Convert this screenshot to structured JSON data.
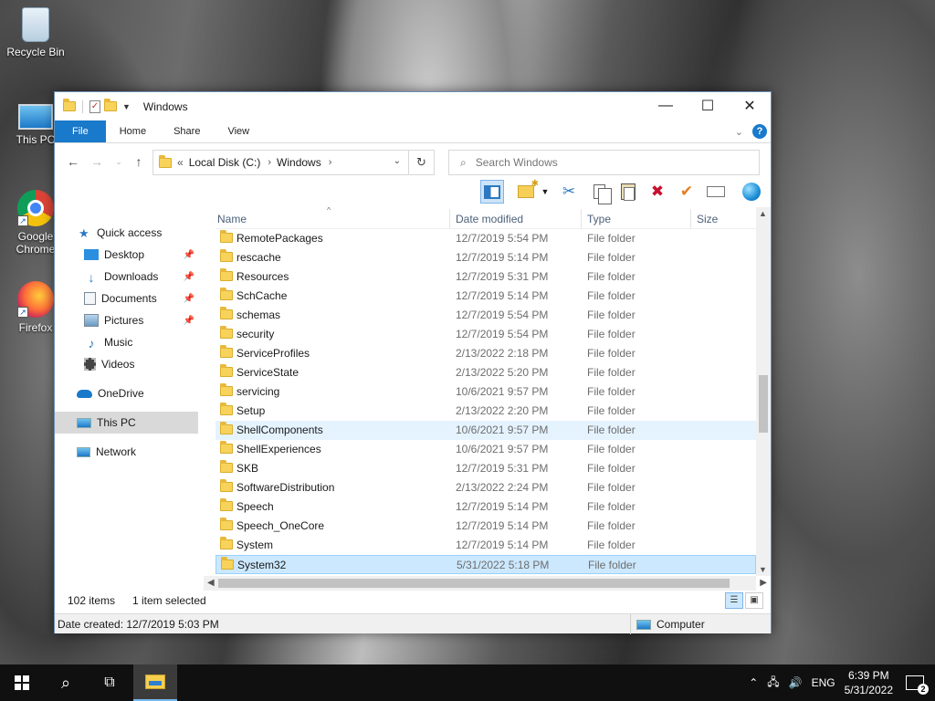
{
  "desktop": {
    "icons": [
      {
        "label": "Recycle Bin"
      },
      {
        "label": "This PC"
      },
      {
        "label": "Google Chrome"
      },
      {
        "label": "Firefox"
      }
    ]
  },
  "window": {
    "title": "Windows",
    "ribbon_tabs": [
      "File",
      "Home",
      "Share",
      "View"
    ],
    "help_label": "?",
    "address": {
      "overflow": "«",
      "segments": [
        "Local Disk (C:)",
        "Windows"
      ]
    },
    "search": {
      "placeholder": "Search Windows"
    },
    "columns": {
      "name": "Name",
      "date": "Date modified",
      "type": "Type",
      "size": "Size"
    },
    "files": [
      {
        "name": "RemotePackages",
        "date": "12/7/2019 5:54 PM",
        "type": "File folder"
      },
      {
        "name": "rescache",
        "date": "12/7/2019 5:14 PM",
        "type": "File folder"
      },
      {
        "name": "Resources",
        "date": "12/7/2019 5:31 PM",
        "type": "File folder"
      },
      {
        "name": "SchCache",
        "date": "12/7/2019 5:14 PM",
        "type": "File folder"
      },
      {
        "name": "schemas",
        "date": "12/7/2019 5:54 PM",
        "type": "File folder"
      },
      {
        "name": "security",
        "date": "12/7/2019 5:54 PM",
        "type": "File folder"
      },
      {
        "name": "ServiceProfiles",
        "date": "2/13/2022 2:18 PM",
        "type": "File folder"
      },
      {
        "name": "ServiceState",
        "date": "2/13/2022 5:20 PM",
        "type": "File folder"
      },
      {
        "name": "servicing",
        "date": "10/6/2021 9:57 PM",
        "type": "File folder"
      },
      {
        "name": "Setup",
        "date": "2/13/2022 2:20 PM",
        "type": "File folder"
      },
      {
        "name": "ShellComponents",
        "date": "10/6/2021 9:57 PM",
        "type": "File folder"
      },
      {
        "name": "ShellExperiences",
        "date": "10/6/2021 9:57 PM",
        "type": "File folder"
      },
      {
        "name": "SKB",
        "date": "12/7/2019 5:31 PM",
        "type": "File folder"
      },
      {
        "name": "SoftwareDistribution",
        "date": "2/13/2022 2:24 PM",
        "type": "File folder"
      },
      {
        "name": "Speech",
        "date": "12/7/2019 5:14 PM",
        "type": "File folder"
      },
      {
        "name": "Speech_OneCore",
        "date": "12/7/2019 5:14 PM",
        "type": "File folder"
      },
      {
        "name": "System",
        "date": "12/7/2019 5:14 PM",
        "type": "File folder"
      },
      {
        "name": "System32",
        "date": "5/31/2022 5:18 PM",
        "type": "File folder"
      }
    ],
    "hovered_index": 10,
    "selected_index": 17,
    "nav": {
      "quick_access": "Quick access",
      "items": [
        "Desktop",
        "Downloads",
        "Documents",
        "Pictures",
        "Music",
        "Videos"
      ],
      "onedrive": "OneDrive",
      "this_pc": "This PC",
      "network": "Network"
    },
    "status": {
      "count": "102 items",
      "selected": "1 item selected"
    },
    "details": {
      "created": "Date created: 12/7/2019 5:03 PM",
      "location": "Computer"
    }
  },
  "taskbar": {
    "language": "ENG",
    "time": "6:39 PM",
    "date": "5/31/2022",
    "notifications": "2"
  },
  "colors": {
    "accent": "#1979ca",
    "selection": "#cce8ff",
    "hover": "#e5f3ff"
  }
}
